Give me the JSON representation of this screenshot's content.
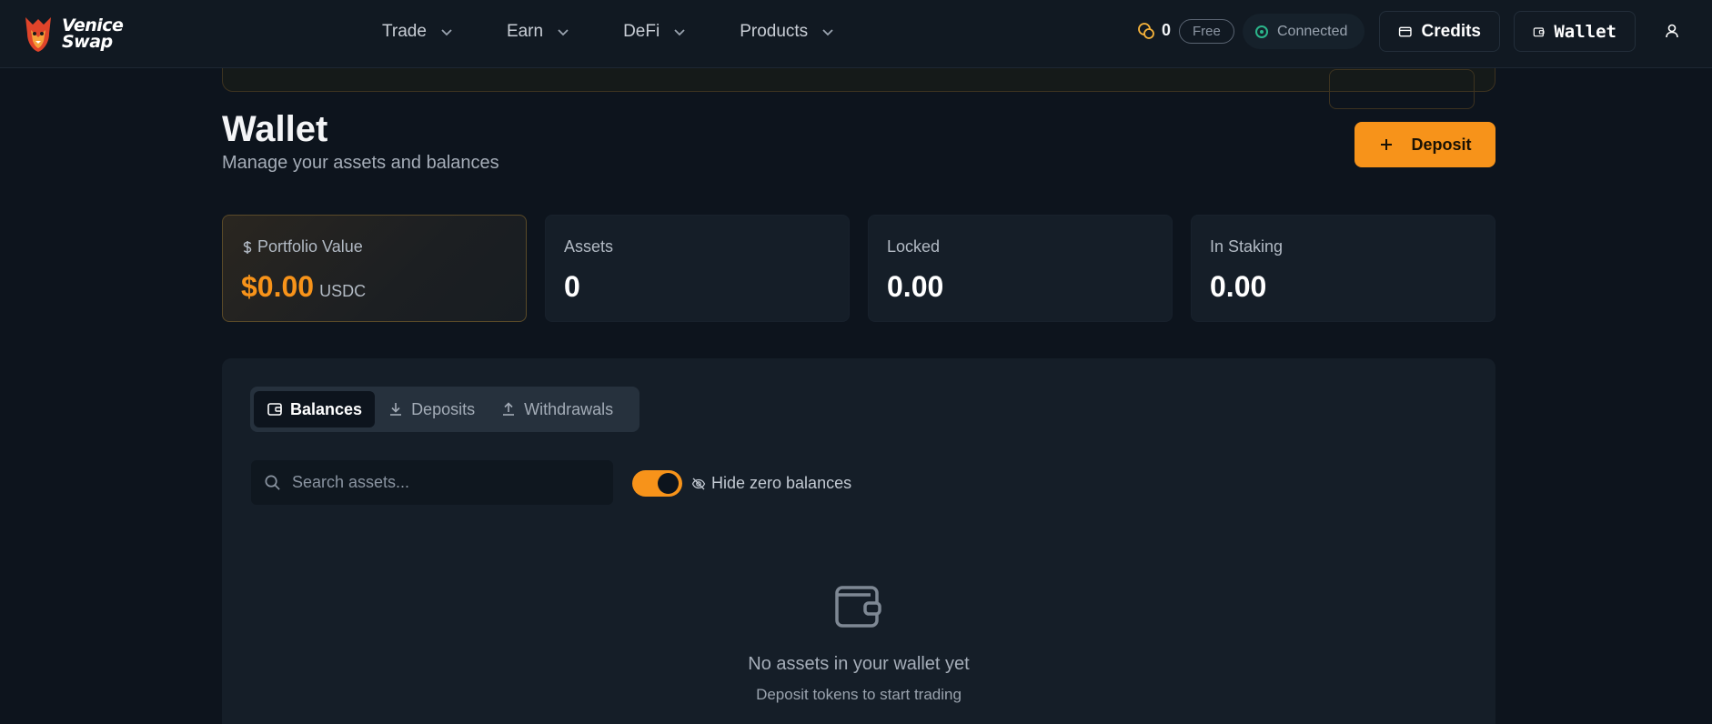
{
  "brand": {
    "line1": "Venice",
    "line2": "Swap"
  },
  "nav": [
    {
      "label": "Trade"
    },
    {
      "label": "Earn"
    },
    {
      "label": "DeFi"
    },
    {
      "label": "Products"
    }
  ],
  "header": {
    "credit_count": "0",
    "plan_badge": "Free",
    "connection_status": "Connected",
    "credits_label": "Credits",
    "wallet_label": "Wallet"
  },
  "page": {
    "title": "Wallet",
    "subtitle": "Manage your assets and balances",
    "deposit_label": "Deposit"
  },
  "stats": {
    "portfolio": {
      "label": "Portfolio Value",
      "value": "$0.00",
      "unit": "USDC"
    },
    "assets": {
      "label": "Assets",
      "value": "0"
    },
    "locked": {
      "label": "Locked",
      "value": "0.00"
    },
    "staking": {
      "label": "In Staking",
      "value": "0.00"
    }
  },
  "tabs": [
    {
      "label": "Balances",
      "active": true
    },
    {
      "label": "Deposits",
      "active": false
    },
    {
      "label": "Withdrawals",
      "active": false
    }
  ],
  "filters": {
    "search_placeholder": "Search assets...",
    "hide_zero_label": "Hide zero balances",
    "hide_zero_enabled": true
  },
  "empty_state": {
    "title": "No assets in your wallet yet",
    "subtitle": "Deposit tokens to start trading"
  },
  "colors": {
    "accent": "#f7931a",
    "background": "#0d141d",
    "card": "#151e28",
    "connected": "#2bb58a"
  }
}
